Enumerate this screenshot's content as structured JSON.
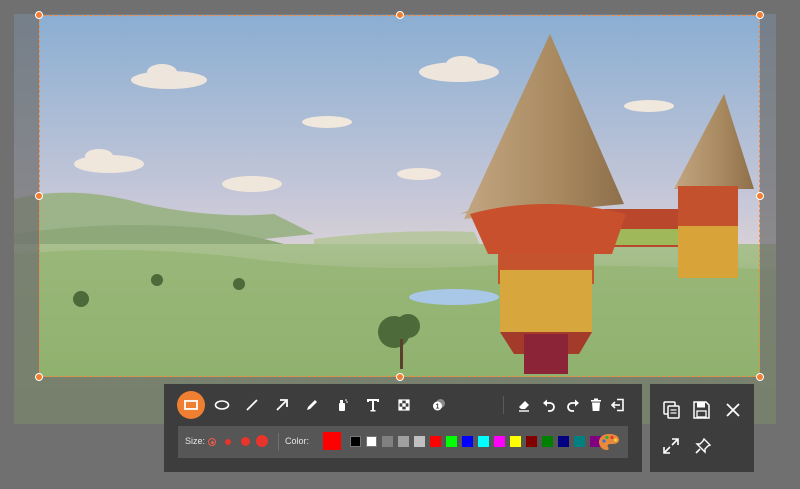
{
  "toolbar": {
    "tools": [
      {
        "name": "rectangle",
        "icon": "rectangle-icon",
        "active": true
      },
      {
        "name": "ellipse",
        "icon": "ellipse-icon",
        "active": false
      },
      {
        "name": "line",
        "icon": "line-icon",
        "active": false
      },
      {
        "name": "arrow",
        "icon": "arrow-icon",
        "active": false
      },
      {
        "name": "pencil",
        "icon": "pencil-icon",
        "active": false
      },
      {
        "name": "spray",
        "icon": "spray-icon",
        "active": false
      },
      {
        "name": "text",
        "icon": "text-icon",
        "active": false
      },
      {
        "name": "mosaic",
        "icon": "mosaic-icon",
        "active": false
      },
      {
        "name": "callout",
        "icon": "callout-icon",
        "active": false
      }
    ],
    "edit_actions": [
      {
        "name": "eraser",
        "icon": "eraser-icon"
      },
      {
        "name": "undo",
        "icon": "undo-icon"
      },
      {
        "name": "redo",
        "icon": "redo-icon"
      },
      {
        "name": "delete",
        "icon": "trash-icon"
      },
      {
        "name": "exit",
        "icon": "exit-icon"
      }
    ],
    "size_label": "Size:",
    "sizes": [
      "smallest",
      "small",
      "medium",
      "large"
    ],
    "selected_size": "smallest",
    "color_label": "Color:",
    "current_color": "#ff0000",
    "palette": [
      "#000000",
      "#ffffff",
      "#808080",
      "#a0a0a0",
      "#c0c0c0",
      "#ff0000",
      "#00ff00",
      "#0000ff",
      "#00ffff",
      "#ff00ff",
      "#ffff00",
      "#800000",
      "#008000",
      "#000080",
      "#008080",
      "#800080"
    ],
    "palette_icon": "palette-icon"
  },
  "actions": [
    {
      "name": "copy",
      "icon": "copy-icon"
    },
    {
      "name": "save",
      "icon": "save-icon"
    },
    {
      "name": "close",
      "icon": "close-icon"
    },
    {
      "name": "fullscreen",
      "icon": "fullscreen-icon"
    },
    {
      "name": "pin",
      "icon": "pin-icon"
    }
  ],
  "colors": {
    "accent": "#f07f32",
    "toolbar_bg": "#3d3d3d",
    "options_bg": "#565656",
    "overlay": "#787878"
  }
}
